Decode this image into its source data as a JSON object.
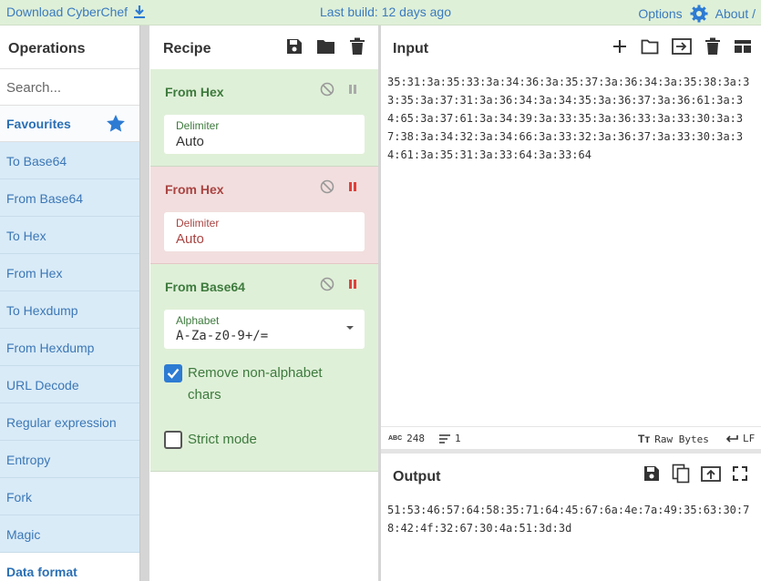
{
  "topbar": {
    "download_label": "Download CyberChef",
    "build_label": "Last build: 12 days ago",
    "options_label": "Options",
    "about_label": "About /"
  },
  "operations": {
    "title": "Operations",
    "search_placeholder": "Search...",
    "favourites_label": "Favourites",
    "items": [
      "To Base64",
      "From Base64",
      "To Hex",
      "From Hex",
      "To Hexdump",
      "From Hexdump",
      "URL Decode",
      "Regular expression",
      "Entropy",
      "Fork",
      "Magic"
    ],
    "category_label": "Data format"
  },
  "recipe": {
    "title": "Recipe",
    "steps": [
      {
        "name": "From Hex",
        "field_label": "Delimiter",
        "field_value": "Auto"
      },
      {
        "name": "From Hex",
        "field_label": "Delimiter",
        "field_value": "Auto"
      },
      {
        "name": "From Base64",
        "field_label": "Alphabet",
        "field_value": "A-Za-z0-9+/=",
        "checkbox1_label": "Remove non-alphabet chars",
        "checkbox2_label": "Strict mode"
      }
    ]
  },
  "input": {
    "title": "Input",
    "text": "35:31:3a:35:33:3a:34:36:3a:35:37:3a:36:34:3a:35:38:3a:33:35:3a:37:31:3a:36:34:3a:34:35:3a:36:37:3a:36:61:3a:34:65:3a:37:61:3a:34:39:3a:33:35:3a:36:33:3a:33:30:3a:37:38:3a:34:32:3a:34:66:3a:33:32:3a:36:37:3a:33:30:3a:34:61:3a:35:31:3a:33:64:3a:33:64"
  },
  "status": {
    "length_label": "ABC",
    "length_value": "248",
    "lines_value": "1",
    "format_label": "Raw Bytes",
    "eol_label": "LF"
  },
  "output": {
    "title": "Output",
    "text": "51:53:46:57:64:58:35:71:64:45:67:6a:4e:7a:49:35:63:30:78:42:4f:32:67:30:4a:51:3d:3d"
  },
  "colors": {
    "accent": "#2d7bd3",
    "green_bg": "#dff0d8",
    "red_bg": "#f2dede",
    "ops_item_bg": "#d9ebf7"
  }
}
